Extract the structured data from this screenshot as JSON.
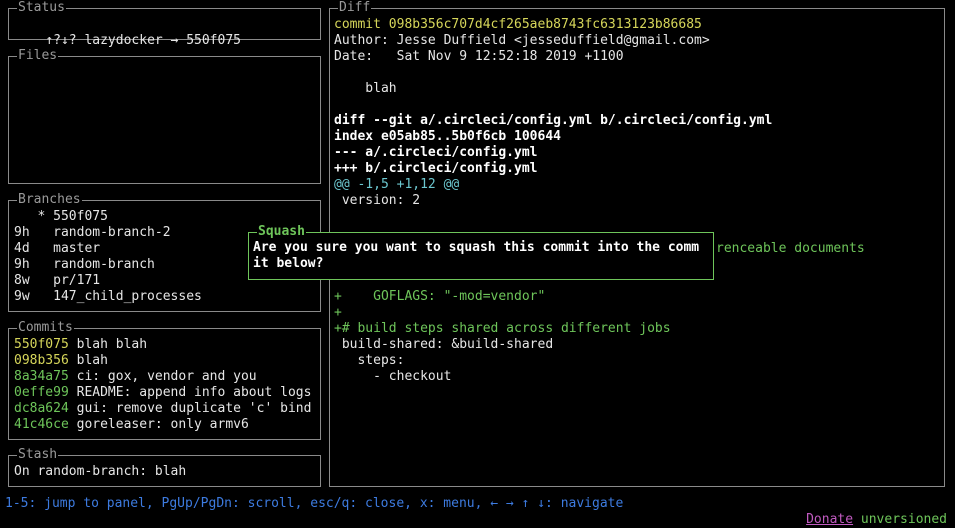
{
  "status": {
    "title": "Status",
    "arrows": "↑?↓?",
    "text": "lazydocker → 550f075"
  },
  "files": {
    "title": "Files"
  },
  "branches": {
    "title": "Branches",
    "items": [
      {
        "age": "  ",
        "marker": " *",
        "name": "550f075"
      },
      {
        "age": "9h",
        "marker": "  ",
        "name": "random-branch-2"
      },
      {
        "age": "4d",
        "marker": "  ",
        "name": "master"
      },
      {
        "age": "9h",
        "marker": "  ",
        "name": "random-branch"
      },
      {
        "age": "8w",
        "marker": "  ",
        "name": "pr/171"
      },
      {
        "age": "9w",
        "marker": "  ",
        "name": "147_child_processes"
      }
    ]
  },
  "commits": {
    "title": "Commits",
    "items": [
      {
        "sha": "550f075",
        "msg": "blah blah",
        "color": "#d6d65a"
      },
      {
        "sha": "098b356",
        "msg": "blah",
        "color": "#d6d65a"
      },
      {
        "sha": "8a34a75",
        "msg": "ci: gox, vendor and you",
        "color": "#6ec55a"
      },
      {
        "sha": "0effe99",
        "msg": "README: append info about logs",
        "color": "#6ec55a"
      },
      {
        "sha": "dc8a624",
        "msg": "gui: remove duplicate 'c' bind",
        "color": "#6ec55a"
      },
      {
        "sha": "41c46ce",
        "msg": "goreleaser: only armv6",
        "color": "#6ec55a"
      }
    ]
  },
  "stash": {
    "title": "Stash",
    "text": "On random-branch: blah"
  },
  "diff": {
    "title": "Diff",
    "commit_line": "commit 098b356c707d4cf265aeb8743fc6313123b86685",
    "author_line": "Author: Jesse Duffield <jesseduffield@gmail.com>",
    "date_line": "Date:   Sat Nov 9 12:52:18 2019 +1100",
    "message_line": "    blah",
    "diff_git": "diff --git a/.circleci/config.yml b/.circleci/config.yml",
    "index": "index e05ab85..5b0f6cb 100644",
    "minus_file": "--- a/.circleci/config.yml",
    "plus_file": "+++ b/.circleci/config.yml",
    "hunk": "@@ -1,5 +1,12 @@",
    "version": " version: 2",
    "partial_green": "renceable documents",
    "goflags": "+    GOFLAGS: \"-mod=vendor\"",
    "plus_empty": "+",
    "build_steps": "+# build steps shared across different jobs",
    "build_shared": " build-shared: &build-shared",
    "steps": "   steps:",
    "checkout": "     - checkout"
  },
  "popup": {
    "title": "Squash",
    "line1": "Are you sure you want to squash this commit into the comm",
    "line2": "it below?"
  },
  "footer": {
    "keys": "1-5: jump to panel, PgUp/PgDn: scroll, esc/q: close, x: menu, ← → ↑ ↓: navigate",
    "donate": "Donate",
    "version": "unversioned"
  }
}
